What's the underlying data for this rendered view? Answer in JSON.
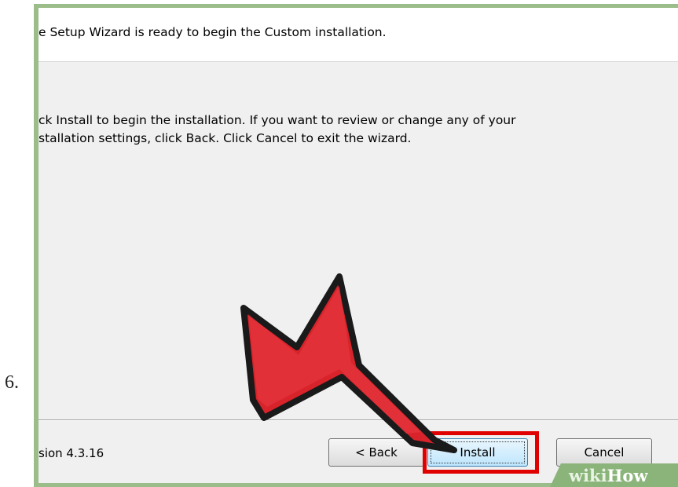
{
  "step_number": "6.",
  "dialog": {
    "header": "e Setup Wizard is ready to begin the Custom installation.",
    "body_lines": [
      "ck Install to begin the installation. If you want to review or change any of your",
      "stallation settings, click Back. Click Cancel to exit the wizard."
    ],
    "version": "sion 4.3.16",
    "buttons": {
      "back": "< Back",
      "install": "Install",
      "cancel": "Cancel"
    }
  },
  "annotations": {
    "arrow_color": "#d8232a",
    "highlight_color": "#e00000",
    "pointer_icon": "big-arrow-icon"
  },
  "watermark": {
    "wiki": "wiki",
    "how": "How"
  }
}
